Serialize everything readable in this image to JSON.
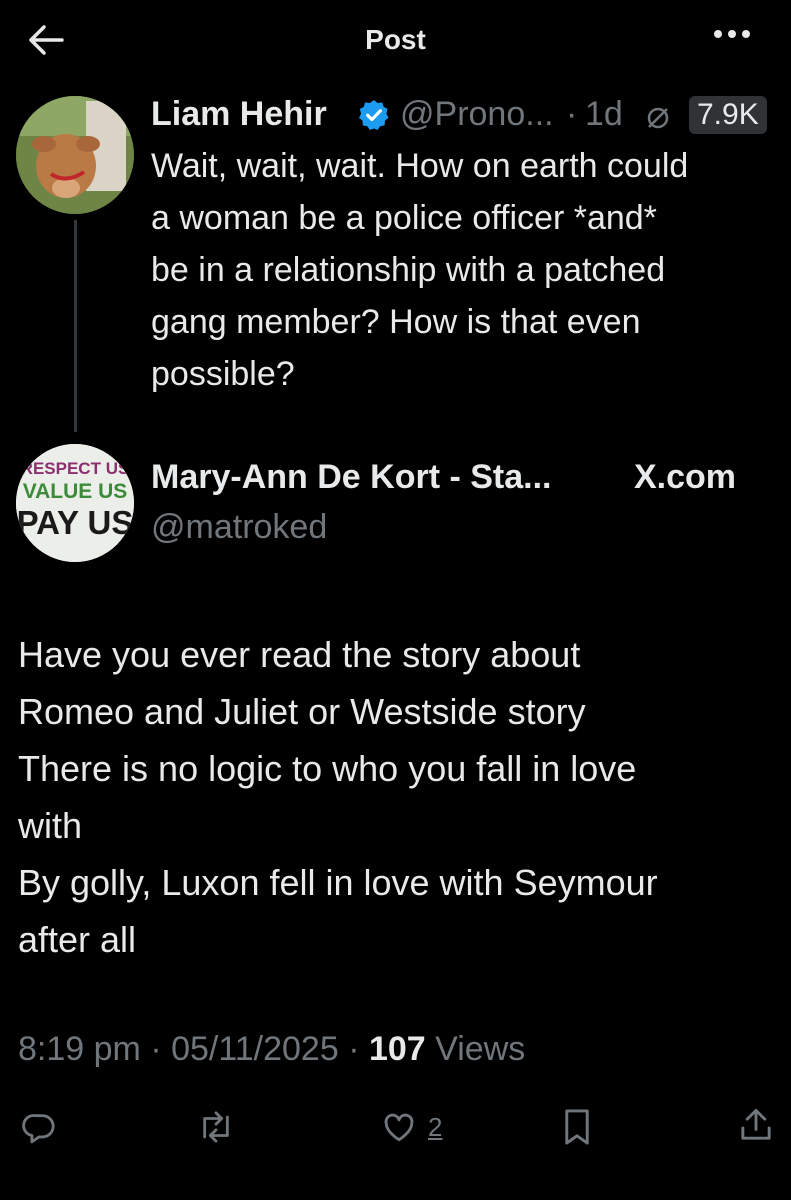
{
  "header": {
    "title": "Post"
  },
  "quoted_tweet": {
    "name": "Liam Hehir",
    "handle": "@Prono...",
    "separator": "·",
    "time": "1d",
    "views": "7.9K",
    "lines": [
      "Wait, wait, wait. How on earth could",
      "a woman be a police officer *and*",
      "be in a relationship with a patched",
      "gang member? How is that even",
      "possible?"
    ]
  },
  "reply_author": {
    "name": "Mary-Ann De Kort - Sta...",
    "handle": "@matroked",
    "source": "X.com",
    "avatar_text": [
      "RESPECT US",
      "VALUE US",
      "PAY US"
    ]
  },
  "post": {
    "lines": [
      "Have you ever read the story about",
      "Romeo and Juliet or Westside story",
      "There is no logic to who you fall in love",
      "with",
      "By golly, Luxon fell in love with Seymour",
      "after all"
    ],
    "time": "8:19 pm",
    "sep": "·",
    "date": "05/11/2025",
    "views_count": "107",
    "views_label": "Views"
  },
  "actions": {
    "likes": "2"
  },
  "icons": [
    "back-arrow-icon",
    "more-icon",
    "verified-icon",
    "views-icon",
    "reply-icon",
    "repost-icon",
    "like-icon",
    "bookmark-icon",
    "share-icon"
  ],
  "colors": {
    "background": "#000000",
    "text": "#e7e9ea",
    "muted": "#71767b",
    "verified": "#1d9bf0"
  }
}
